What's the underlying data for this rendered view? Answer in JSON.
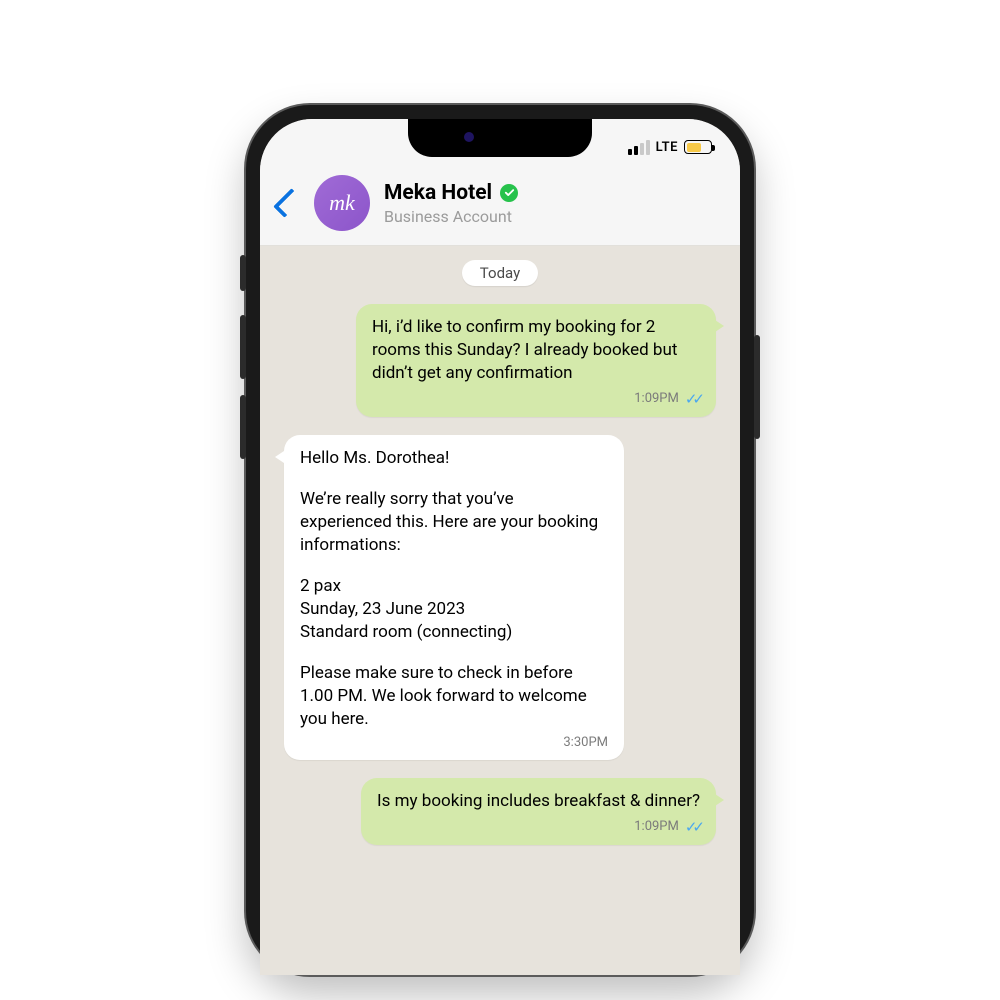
{
  "status": {
    "network_label": "LTE"
  },
  "header": {
    "avatar_text": "mk",
    "contact_name": "Meka Hotel",
    "subtitle": "Business Account"
  },
  "chat": {
    "date_label": "Today",
    "msg1": {
      "text": "Hi, i’d like to confirm my booking for 2 rooms this Sunday? I already booked but didn’t get any confirmation",
      "time": "1:09PM"
    },
    "msg2": {
      "p1": "Hello Ms. Dorothea!",
      "p2": "We’re really sorry that you’ve experienced this. Here are your booking informations:",
      "p3": "2 pax\nSunday, 23 June 2023\nStandard room (connecting)",
      "p4": "Please make sure to check in before 1.00 PM. We look forward to welcome you here.",
      "time": "3:30PM"
    },
    "msg3": {
      "text": "Is my booking includes breakfast & dinner?",
      "time": "1:09PM"
    }
  }
}
